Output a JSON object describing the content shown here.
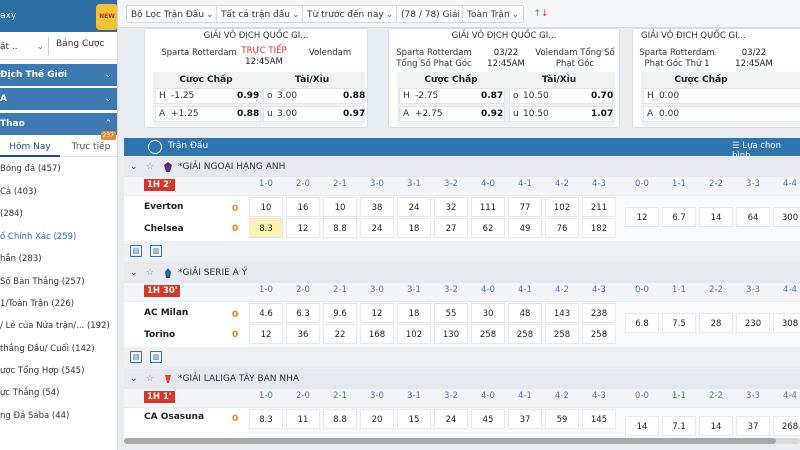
{
  "sidebar": {
    "top_text": "axy",
    "badge": "NEW",
    "select_label": "ật ..",
    "bang_cuoc": "Bảng Cược",
    "heads": [
      {
        "label": "Địch Thế Giới",
        "chev": "⌄"
      },
      {
        "label": "A",
        "chev": "⌄"
      },
      {
        "label": "Thao",
        "chev": "⌃"
      }
    ],
    "tabs": {
      "today": "Hôm Nay",
      "live": "Trực tiếp",
      "live_count": "237"
    },
    "items": [
      "Bóng đá (457)",
      "Cả (403)",
      "(284)",
      "ố Chính Xác (259)",
      "hẳn (283)",
      "Số Bàn Thắng (257)",
      "1/Toàn Trận (226)",
      "/ Lẻ của Nửa trận/... (192)",
      "thắng Đầu/ Cuối (142)",
      "ược Tổng Hợp (545)",
      "ực Thắng (54)",
      "ng Đá Saba (44)"
    ]
  },
  "filters": {
    "filter1": "Bộ Lọc Trận Đấu",
    "filter2": "Tất cả trận đấu",
    "filter3": "Từ trước đến nay",
    "filter4": "(78 / 78) Giải",
    "filter5": "Toàn Trận",
    "trend": "↑↓"
  },
  "featured": [
    {
      "league": "GIẢI VÔ ĐỊCH QUỐC GI...",
      "home": "Sparta Rotterdam",
      "mid_top": "TRỰC TIẾP",
      "mid_bottom": "12:45AM",
      "away": "Volendam",
      "h_label": "Cược Chấp",
      "o_label": "Tài/Xỉu",
      "rows": [
        {
          "l1": "H",
          "v1": "-1.25",
          "o1": "0.99",
          "l2": "o",
          "v2": "3.00",
          "o2": "0.88"
        },
        {
          "l1": "A",
          "v1": "+1.25",
          "o1": "0.88",
          "l2": "u",
          "v2": "3.00",
          "o2": "0.97"
        }
      ]
    },
    {
      "league": "GIẢI VÔ ĐỊCH QUỐC GI...",
      "home": "Sparta Rotterdam Tổng Số Phạt Góc",
      "mid_top": "03/22",
      "mid_bottom": "12:45AM",
      "away": "Volendam Tổng Số Phạt Góc",
      "h_label": "Cược Chấp",
      "o_label": "Tài/Xỉu",
      "rows": [
        {
          "l1": "H",
          "v1": "-2.75",
          "o1": "0.87",
          "l2": "o",
          "v2": "10.50",
          "o2": "0.70"
        },
        {
          "l1": "A",
          "v1": "+2.75",
          "o1": "0.92",
          "l2": "u",
          "v2": "10.50",
          "o2": "1.07"
        }
      ]
    },
    {
      "league": "GIẢI VÔ ĐỊCH QUỐC GI...",
      "home": "Sparta Rotterdam Phạt Góc Thứ 1",
      "mid_top": "03/22",
      "mid_bottom": "12:45AM",
      "away": "",
      "h_label": "Cược Chấp",
      "rows": [
        {
          "l1": "H",
          "v1": "0.00"
        },
        {
          "l1": "A",
          "v1": "0.00"
        }
      ]
    }
  ],
  "table": {
    "title": "Trận Đấu",
    "right_label": "Lựa chọn bình",
    "score_headers": [
      "1-0",
      "2-0",
      "2-1",
      "3-0",
      "3-1",
      "3-2",
      "4-0",
      "4-1",
      "4-2",
      "4-3",
      "0-0",
      "1-1",
      "2-2",
      "3-3",
      "4-4"
    ]
  },
  "leagues": [
    {
      "name": "*GIẢI NGOẠI HẠNG ANH",
      "time": "1H 2'",
      "home": "Everton",
      "home_score": "0",
      "away": "Chelsea",
      "away_score": "0",
      "home_odds": [
        "10",
        "16",
        "10",
        "38",
        "24",
        "32",
        "111",
        "77",
        "102",
        "211"
      ],
      "away_odds": [
        "8.3",
        "12",
        "8.8",
        "24",
        "18",
        "27",
        "62",
        "49",
        "76",
        "182"
      ],
      "draw_odds": [
        "12",
        "6.7",
        "14",
        "64",
        "300"
      ]
    },
    {
      "name": "*GIẢI SERIE A Ý",
      "time": "1H 30'",
      "home": "AC Milan",
      "home_score": "0",
      "away": "Torino",
      "away_score": "0",
      "home_odds": [
        "4.6",
        "6.3",
        "9.6",
        "12",
        "18",
        "55",
        "30",
        "48",
        "143",
        "238"
      ],
      "away_odds": [
        "12",
        "36",
        "22",
        "168",
        "102",
        "130",
        "258",
        "258",
        "258",
        "258"
      ],
      "draw_odds": [
        "6.8",
        "7.5",
        "28",
        "230",
        "308"
      ]
    },
    {
      "name": "*GIẢI LALIGA TÂY BAN NHA",
      "time": "1H 1'",
      "home": "CA Osasuna",
      "home_score": "0",
      "away": "",
      "away_score": "",
      "home_odds": [
        "8.3",
        "11",
        "8.8",
        "20",
        "15",
        "24",
        "45",
        "37",
        "59",
        "145"
      ],
      "away_odds": [],
      "draw_odds": [
        "14",
        "7.1",
        "14",
        "37",
        "268"
      ]
    }
  ]
}
